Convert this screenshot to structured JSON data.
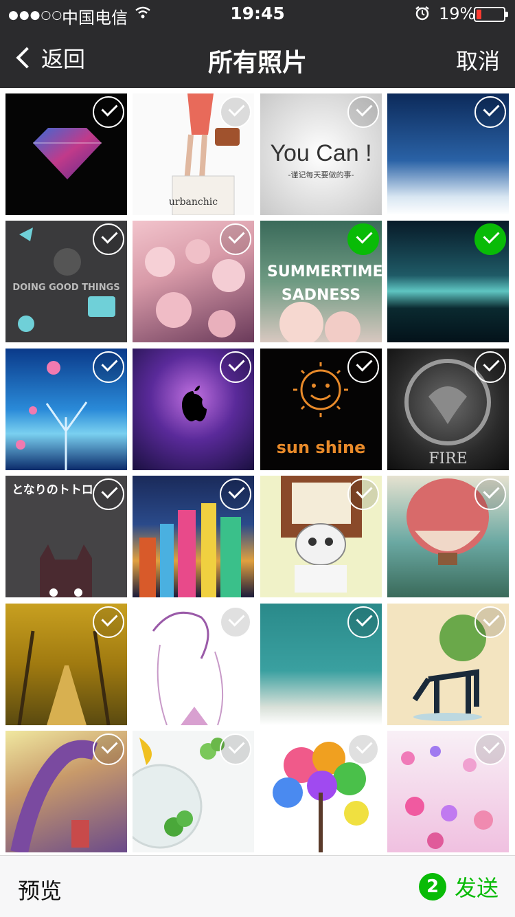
{
  "status_bar": {
    "signal": "●●●○○",
    "carrier": "中国电信",
    "time": "19:45",
    "battery_percent": "19%",
    "battery_level": 0.19,
    "icons": [
      "wifi-icon",
      "alarm-icon",
      "battery-icon"
    ]
  },
  "nav": {
    "back_label": "返回",
    "title": "所有照片",
    "cancel_label": "取消"
  },
  "photos": [
    {
      "selected": false,
      "text": ""
    },
    {
      "selected": false,
      "text": "urbanchic"
    },
    {
      "selected": false,
      "text": "You Can !",
      "subtext": "-谨记每天要做的事-"
    },
    {
      "selected": false,
      "text": ""
    },
    {
      "selected": false,
      "text": "DOING GOOD THINGS"
    },
    {
      "selected": false,
      "text": ""
    },
    {
      "selected": true,
      "text": "SUMMERTIME SADNESS"
    },
    {
      "selected": true,
      "text": ""
    },
    {
      "selected": false,
      "text": ""
    },
    {
      "selected": false,
      "text": ""
    },
    {
      "selected": false,
      "text": "sun shine"
    },
    {
      "selected": false,
      "text": "FIRE"
    },
    {
      "selected": false,
      "text": "となりのトトロ"
    },
    {
      "selected": false,
      "text": ""
    },
    {
      "selected": false,
      "text": ""
    },
    {
      "selected": false,
      "text": ""
    },
    {
      "selected": false,
      "text": ""
    },
    {
      "selected": false,
      "text": ""
    },
    {
      "selected": false,
      "text": ""
    },
    {
      "selected": false,
      "text": ""
    },
    {
      "selected": false,
      "text": ""
    },
    {
      "selected": false,
      "text": ""
    },
    {
      "selected": false,
      "text": ""
    },
    {
      "selected": false,
      "text": ""
    }
  ],
  "bottom_bar": {
    "preview_label": "预览",
    "selected_count": "2",
    "send_label": "发送"
  },
  "colors": {
    "accent": "#09bb07",
    "nav_background": "#2b2b2d"
  }
}
